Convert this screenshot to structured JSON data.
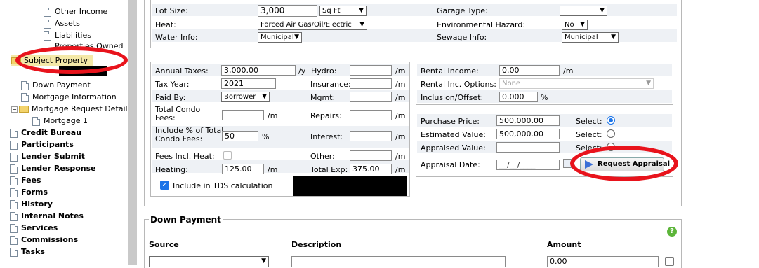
{
  "sidebar": {
    "items": [
      {
        "label": "Other Income"
      },
      {
        "label": "Assets"
      },
      {
        "label": "Liabilities"
      },
      {
        "label": "Properties Owned"
      },
      {
        "label": "Subject Property"
      },
      {
        "label": "Down Payment"
      },
      {
        "label": "Mortgage Information"
      },
      {
        "label": "Mortgage Request Detail"
      },
      {
        "label": "Mortgage 1"
      },
      {
        "label": "Credit Bureau"
      },
      {
        "label": "Participants"
      },
      {
        "label": "Lender Submit"
      },
      {
        "label": "Lender Response"
      },
      {
        "label": "Fees"
      },
      {
        "label": "Forms"
      },
      {
        "label": "History"
      },
      {
        "label": "Internal Notes"
      },
      {
        "label": "Services"
      },
      {
        "label": "Commissions"
      },
      {
        "label": "Tasks"
      }
    ]
  },
  "property": {
    "lot_size_label": "Lot Size:",
    "lot_size_value": "3,000",
    "lot_unit": "Sq Ft",
    "garage_label": "Garage Type:",
    "garage_value": "",
    "heat_label": "Heat:",
    "heat_value": "Forced Air Gas/Oil/Electric",
    "env_label": "Environmental Hazard:",
    "env_value": "No",
    "water_label": "Water Info:",
    "water_value": "Municipal",
    "sewage_label": "Sewage Info:",
    "sewage_value": "Municipal"
  },
  "taxes": {
    "annual_taxes_label": "Annual Taxes:",
    "annual_taxes_value": "3,000.00",
    "per_year": "/y",
    "hydro_label": "Hydro:",
    "per_month": "/m",
    "tax_year_label": "Tax Year:",
    "tax_year_value": "2021",
    "insurance_label": "Insurance:",
    "paid_by_label": "Paid By:",
    "paid_by_value": "Borrower",
    "mgmt_label": "Mgmt:",
    "condo_fees_label_1": "Total Condo",
    "condo_fees_label_2": "Fees:",
    "repairs_label": "Repairs:",
    "include_pct_label_1": "Include % of Total",
    "include_pct_label_2": "Condo Fees:",
    "include_pct_value": "50",
    "pct": "%",
    "interest_label": "Interest:",
    "fees_heat_label": "Fees Incl. Heat:",
    "other_label": "Other:",
    "heating_label": "Heating:",
    "heating_value": "125.00",
    "total_exp_label": "Total Exp:",
    "total_exp_value": "375.00",
    "tds_label": "Include in TDS calculation"
  },
  "rental": {
    "income_label": "Rental Income:",
    "income_value": "0.00",
    "per_month": "/m",
    "options_label": "Rental Inc. Options:",
    "options_value": "None",
    "offset_label": "Inclusion/Offset:",
    "offset_value": "0.000",
    "pct": "%"
  },
  "valuation": {
    "purchase_label": "Purchase Price:",
    "purchase_value": "500,000.00",
    "estimated_label": "Estimated Value:",
    "estimated_value": "500,000.00",
    "appraised_label": "Appraised Value:",
    "appraisal_date_label": "Appraisal Date:",
    "appraisal_date_value": "__/__/____",
    "select_label": "Select:",
    "request_appraisal": "Request Appraisal"
  },
  "down_payment": {
    "title": "Down Payment",
    "col_source": "Source",
    "col_description": "Description",
    "col_amount": "Amount",
    "amount_value": "0.00"
  },
  "colors": {
    "accent": "#1a73e8",
    "annotation": "#e8131c",
    "row_alt": "#eef1f5"
  }
}
